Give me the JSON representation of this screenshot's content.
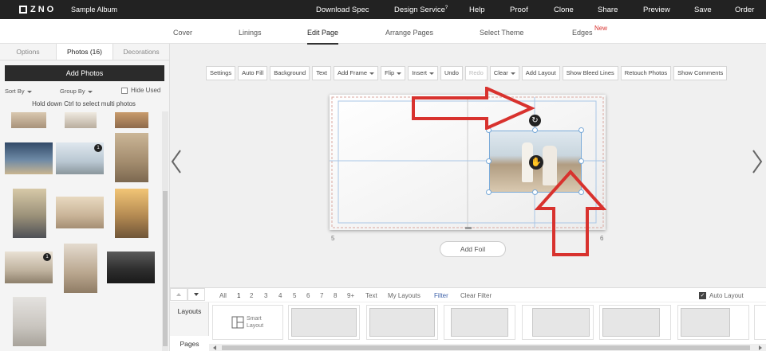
{
  "header": {
    "logo": "ZNO",
    "album_title": "Sample Album",
    "nav": [
      {
        "label": "Download Spec",
        "badge": ""
      },
      {
        "label": "Design Service",
        "badge": "?"
      },
      {
        "label": "Help",
        "badge": ""
      },
      {
        "label": "Proof",
        "badge": ""
      },
      {
        "label": "Clone",
        "badge": ""
      },
      {
        "label": "Share",
        "badge": ""
      },
      {
        "label": "Preview",
        "badge": ""
      },
      {
        "label": "Save",
        "badge": ""
      },
      {
        "label": "Order",
        "badge": ""
      }
    ]
  },
  "subnav": {
    "items": [
      {
        "label": "Cover",
        "active": false
      },
      {
        "label": "Linings",
        "active": false
      },
      {
        "label": "Edit Page",
        "active": true
      },
      {
        "label": "Arrange Pages",
        "active": false
      },
      {
        "label": "Select Theme",
        "active": false
      },
      {
        "label": "Edges",
        "active": false
      }
    ],
    "new_badge": "New"
  },
  "left_panel": {
    "tabs": [
      {
        "label": "Options",
        "active": false
      },
      {
        "label": "Photos (16)",
        "active": true
      },
      {
        "label": "Decorations",
        "active": false
      }
    ],
    "add_photos": "Add Photos",
    "sort_by": "Sort By",
    "group_by": "Group By",
    "hide_used": "Hide Used",
    "hint": "Hold down Ctrl to select multi photos",
    "photos": [
      {
        "badge": ""
      },
      {
        "badge": ""
      },
      {
        "badge": ""
      },
      {
        "badge": ""
      },
      {
        "badge": "1"
      },
      {
        "badge": ""
      },
      {
        "badge": ""
      },
      {
        "badge": ""
      },
      {
        "badge": ""
      },
      {
        "badge": "1"
      },
      {
        "badge": ""
      },
      {
        "badge": ""
      },
      {
        "badge": ""
      }
    ]
  },
  "toolbar": {
    "buttons": [
      {
        "label": "Settings",
        "dropdown": false,
        "disabled": false
      },
      {
        "label": "Auto Fill",
        "dropdown": false,
        "disabled": false
      },
      {
        "label": "Background",
        "dropdown": false,
        "disabled": false
      },
      {
        "label": "Text",
        "dropdown": false,
        "disabled": false
      },
      {
        "label": "Add Frame",
        "dropdown": true,
        "disabled": false
      },
      {
        "label": "Flip",
        "dropdown": true,
        "disabled": false
      },
      {
        "label": "Insert",
        "dropdown": true,
        "disabled": false
      },
      {
        "label": "Undo",
        "dropdown": false,
        "disabled": false
      },
      {
        "label": "Redo",
        "dropdown": false,
        "disabled": true
      },
      {
        "label": "Clear",
        "dropdown": true,
        "disabled": false
      },
      {
        "label": "Add Layout",
        "dropdown": false,
        "disabled": false
      },
      {
        "label": "Show Bleed Lines",
        "dropdown": false,
        "disabled": false
      },
      {
        "label": "Retouch Photos",
        "dropdown": false,
        "disabled": false
      },
      {
        "label": "Show Comments",
        "dropdown": false,
        "disabled": false
      }
    ]
  },
  "canvas": {
    "left_page_number": "5",
    "right_page_number": "6",
    "add_foil": "Add Foil"
  },
  "bottom": {
    "filters": [
      "All",
      "1",
      "2",
      "3",
      "4",
      "5",
      "6",
      "7",
      "8",
      "9+",
      "Text",
      "My Layouts",
      "Filter",
      "Clear Filter"
    ],
    "auto_layout": "Auto Layout",
    "tabs": [
      "Layouts",
      "Pages"
    ],
    "smart_layout_line1": "Smart",
    "smart_layout_line2": "Layout"
  },
  "colors": {
    "topbar": "#222222",
    "accent_red": "#d8322e",
    "filter_blue": "#3a5fa8"
  }
}
